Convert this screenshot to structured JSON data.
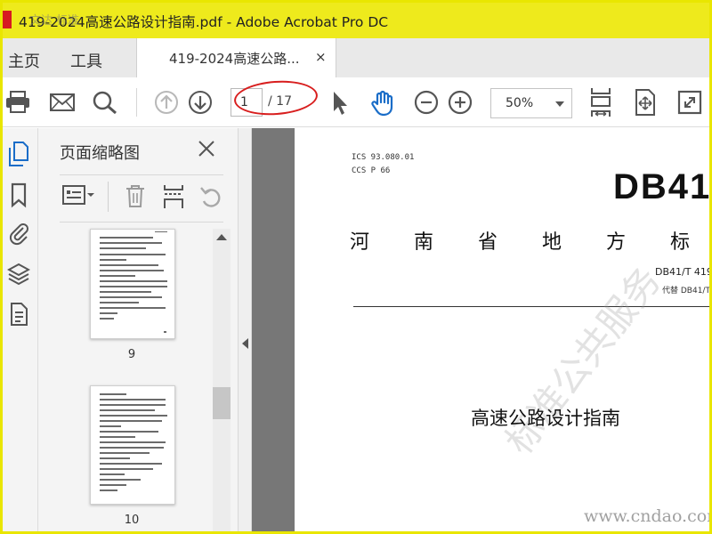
{
  "window": {
    "title": "419-2024高速公路设计指南.pdf - Adobe Acrobat Pro DC",
    "watermark_text": "文达 标准"
  },
  "nav": {
    "home_label": "主页",
    "tools_label": "工具"
  },
  "tab": {
    "label": "419-2024高速公路...",
    "close_glyph": "×"
  },
  "toolbar": {
    "icons": [
      "print-icon",
      "email-icon",
      "search-icon",
      "prev-page-icon",
      "next-page-icon",
      "select-cursor-icon",
      "hand-tool-icon",
      "zoom-out-icon",
      "zoom-in-icon",
      "fit-page-icon",
      "rotate-fit-icon",
      "full-screen-icon"
    ],
    "page_current": "1",
    "page_total": "/ 17",
    "zoom": "50%",
    "annotation_color": "#d81e1e"
  },
  "left_rail": {
    "icons": [
      "page-thumbnails-icon",
      "bookmark-icon",
      "attachment-icon",
      "layers-icon",
      "document-properties-icon"
    ]
  },
  "thumbnails_panel": {
    "title": "页面缩略图",
    "tool_icons": [
      "page-options-icon",
      "delete-icon",
      "insert-page-icon",
      "undo-icon"
    ],
    "pages": [
      {
        "label": "9"
      },
      {
        "label": "10"
      }
    ]
  },
  "document": {
    "ics": "ICS  93.080.01",
    "ccs": "CCS  P  66",
    "std_code": "DB41",
    "org": "河南省地方标",
    "std_number": "DB41/T 419",
    "replaces": "代替 DB41/T",
    "title": "高速公路设计指南",
    "watermark": "标准公共服务",
    "site_watermark": "www.cndao.com"
  },
  "colors": {
    "titlebar": "#eeea1c",
    "frame_border": "#e9e600",
    "accent_blue": "#1a6dc8",
    "doc_background": "#777777"
  }
}
